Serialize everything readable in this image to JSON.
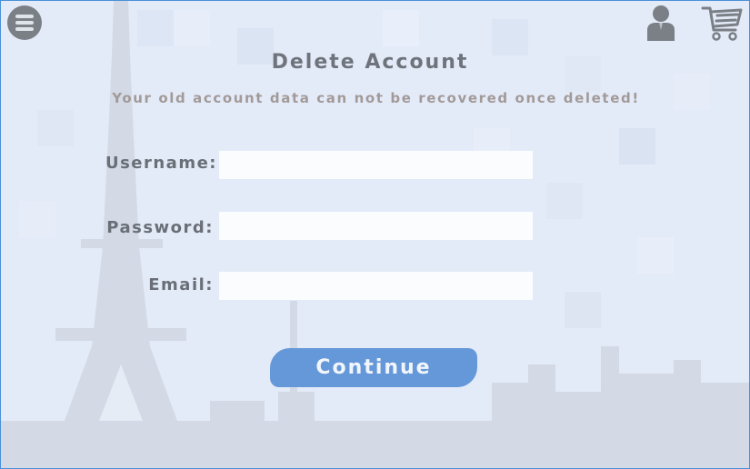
{
  "page": {
    "title": "Delete Account",
    "subtitle": "Your old account data can not be recovered once deleted!"
  },
  "form": {
    "username_label": "Username:",
    "username_value": "",
    "password_label": "Password:",
    "password_value": "",
    "email_label": "Email:",
    "email_value": ""
  },
  "actions": {
    "continue_label": "Continue"
  },
  "toolbar": {
    "menu_icon": "hamburger-menu-icon",
    "user_icon": "user-profile-icon",
    "cart_icon": "shopping-cart-icon"
  },
  "colors": {
    "background": "#e4ebf8",
    "accent": "#6598d8",
    "title_text": "#6f747c",
    "warning_text": "#a29a99",
    "frame_border": "#4a90d9"
  }
}
